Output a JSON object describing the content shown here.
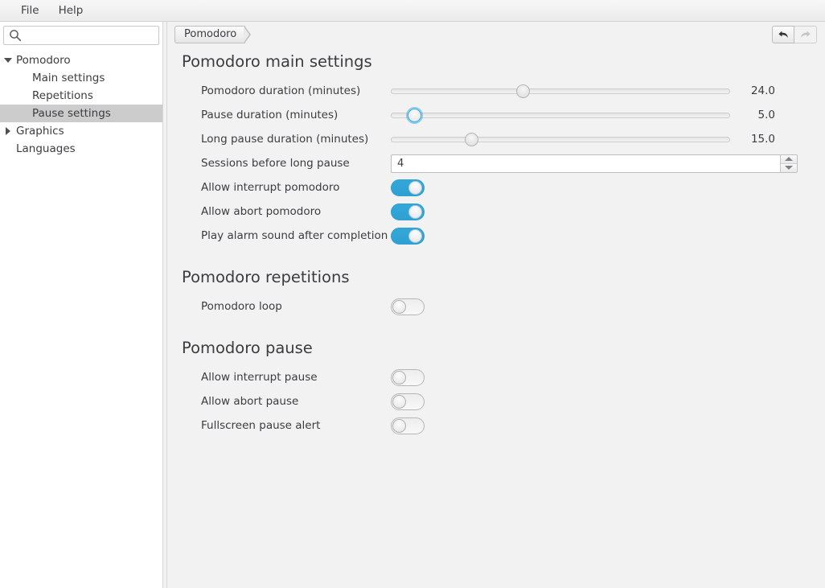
{
  "window": {
    "title": "Pomodoro"
  },
  "menubar": {
    "items": [
      {
        "label": "File"
      },
      {
        "label": "Help"
      }
    ]
  },
  "sidebar": {
    "search": {
      "value": "",
      "placeholder": "",
      "icon": "search-icon"
    },
    "tree": [
      {
        "label": "Pomodoro",
        "level": 0,
        "expander": "expanded",
        "selected": false
      },
      {
        "label": "Main settings",
        "level": 1,
        "expander": "none",
        "selected": false
      },
      {
        "label": "Repetitions",
        "level": 1,
        "expander": "none",
        "selected": false
      },
      {
        "label": "Pause settings",
        "level": 1,
        "expander": "none",
        "selected": true
      },
      {
        "label": "Graphics",
        "level": 0,
        "expander": "collapsed",
        "selected": false
      },
      {
        "label": "Languages",
        "level": 0,
        "expander": "none",
        "selected": false
      }
    ]
  },
  "toolbar": {
    "breadcrumb": [
      {
        "label": "Pomodoro"
      }
    ],
    "undo": {
      "icon": "undo-arrow-icon",
      "enabled": true
    },
    "redo": {
      "icon": "redo-arrow-icon",
      "enabled": false
    }
  },
  "sections": [
    {
      "title": "Pomodoro main settings",
      "rows": [
        {
          "label": "Pomodoro duration (minutes)",
          "control": "slider",
          "value": "24.0",
          "percent": 39
        },
        {
          "label": "Pause duration (minutes)",
          "control": "slider",
          "value": "5.0",
          "percent": 7,
          "focused": true
        },
        {
          "label": "Long pause duration (minutes)",
          "control": "slider",
          "value": "15.0",
          "percent": 24
        },
        {
          "label": "Sessions before long pause",
          "control": "spin",
          "value": "4"
        },
        {
          "label": "Allow interrupt pomodoro",
          "control": "toggle",
          "on": true
        },
        {
          "label": "Allow abort pomodoro",
          "control": "toggle",
          "on": true
        },
        {
          "label": "Play alarm sound after completion",
          "control": "toggle",
          "on": true
        }
      ]
    },
    {
      "title": "Pomodoro repetitions",
      "rows": [
        {
          "label": "Pomodoro loop",
          "control": "toggle",
          "on": false
        }
      ]
    },
    {
      "title": "Pomodoro pause",
      "rows": [
        {
          "label": "Allow interrupt pause",
          "control": "toggle",
          "on": false
        },
        {
          "label": "Allow abort pause",
          "control": "toggle",
          "on": false
        },
        {
          "label": "Fullscreen pause alert",
          "control": "toggle",
          "on": false
        }
      ]
    }
  ],
  "colors": {
    "accent": "#33a8d8",
    "focus_ring": "#3aade0",
    "selection": "#cccccc",
    "window_bg": "#f2f2f2",
    "sidebar_bg": "#ffffff",
    "text": "#3a3c40"
  }
}
